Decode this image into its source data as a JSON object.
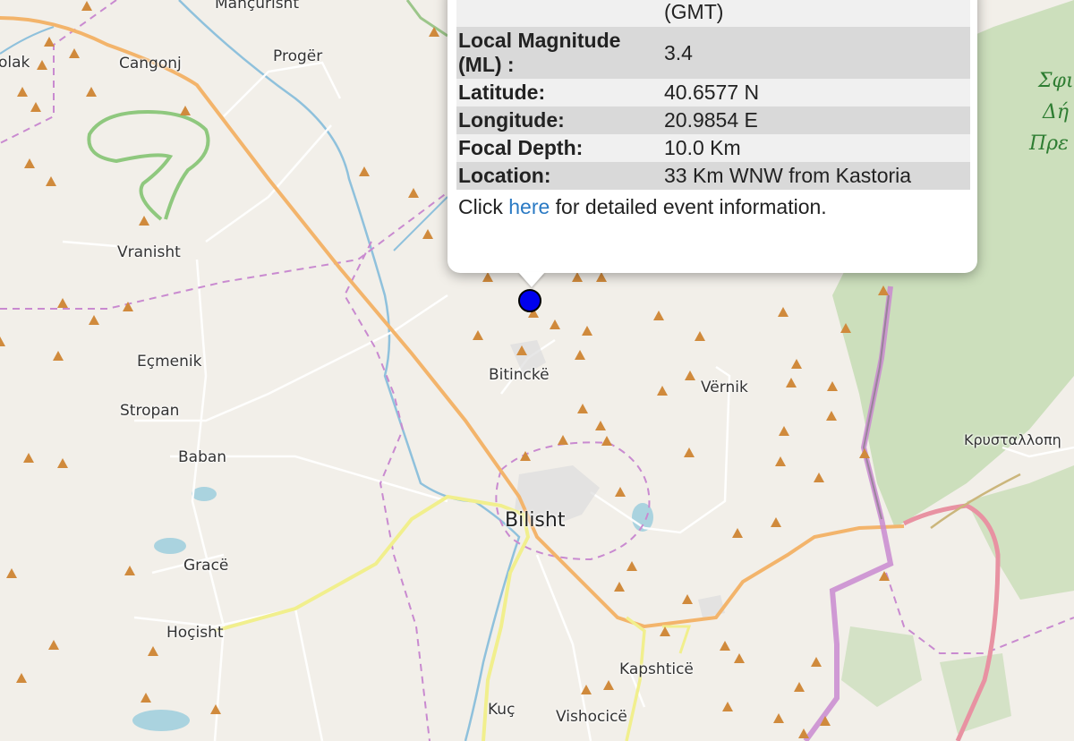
{
  "map": {
    "places": [
      {
        "name": "Mançurisht"
      },
      {
        "name": "olak"
      },
      {
        "name": "Cangonj"
      },
      {
        "name": "Progër"
      },
      {
        "name": "Vranisht"
      },
      {
        "name": "Eçmenik"
      },
      {
        "name": "Stropan"
      },
      {
        "name": "Bitinckë"
      },
      {
        "name": "Vërnik"
      },
      {
        "name": "Baban"
      },
      {
        "name": "Bilisht"
      },
      {
        "name": "Gracë"
      },
      {
        "name": "Hoçisht"
      },
      {
        "name": "Kapshticë"
      },
      {
        "name": "Kuç"
      },
      {
        "name": "Vishocicë"
      },
      {
        "name": "Κρυσταλλοπη"
      }
    ],
    "region_label": [
      "Σφι",
      "Δή",
      "Πρε"
    ],
    "colors": {
      "background": "#f2efe9",
      "forest": "#c8ddb7",
      "main_road": "#f3b46b",
      "secondary_road": "#f1ef8d",
      "border": "#c98ad0",
      "river": "#8fc1dc",
      "volcano_peak": "#d08a3c",
      "marker": "#0000ee"
    }
  },
  "popup": {
    "rows": [
      {
        "key": "",
        "value": "(GMT)"
      },
      {
        "key": "Local Magnitude (ML) :",
        "value": "3.4"
      },
      {
        "key": "Latitude:",
        "value": "40.6577 N"
      },
      {
        "key": "Longitude:",
        "value": "20.9854 E"
      },
      {
        "key": "Focal Depth:",
        "value": "10.0 Km"
      },
      {
        "key": "Location:",
        "value": "33 Km WNW from Kastoria"
      }
    ],
    "footer_prefix": "Click",
    "footer_link": "here",
    "footer_suffix": "for detailed event information."
  },
  "marker": {
    "icon": "event-marker-icon"
  }
}
